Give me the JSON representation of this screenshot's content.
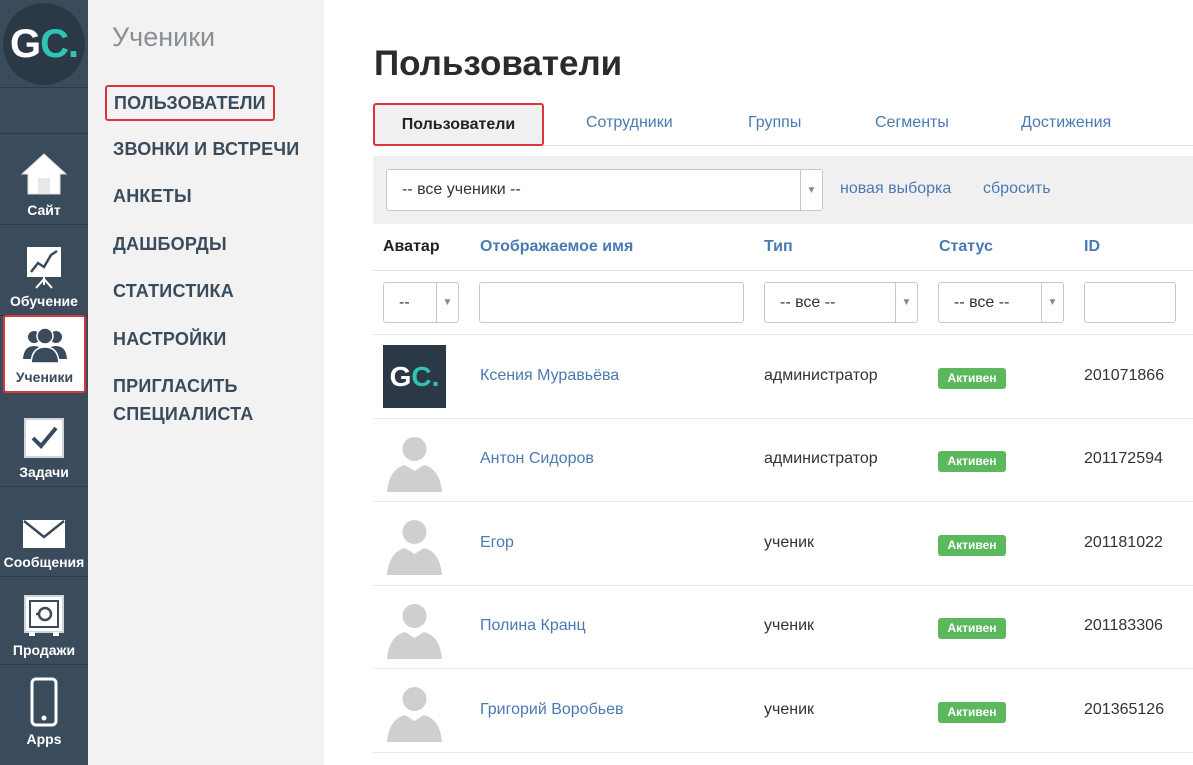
{
  "logo": {
    "g": "G",
    "c": "C."
  },
  "iconbar": {
    "items": [
      {
        "label": "Сайт",
        "icon": "home-icon"
      },
      {
        "label": "Обучение",
        "icon": "chart-board-icon"
      },
      {
        "label": "Ученики",
        "icon": "users-icon"
      },
      {
        "label": "Задачи",
        "icon": "checkbox-icon"
      },
      {
        "label": "Сообщения",
        "icon": "envelope-icon"
      },
      {
        "label": "Продажи",
        "icon": "safe-icon"
      },
      {
        "label": "Apps",
        "icon": "phone-icon"
      }
    ]
  },
  "sidebar": {
    "title": "Ученики",
    "links": [
      "ПОЛЬЗОВАТЕЛИ",
      "ЗВОНКИ И ВСТРЕЧИ",
      "АНКЕТЫ",
      "ДАШБОРДЫ",
      "СТАТИСТИКА",
      "НАСТРОЙКИ",
      "ПРИГЛАСИТЬ",
      "СПЕЦИАЛИСТА"
    ]
  },
  "main": {
    "title": "Пользователи",
    "tabs": [
      "Пользователи",
      "Сотрудники",
      "Группы",
      "Сегменты",
      "Достижения"
    ],
    "filter": {
      "selected": "-- все ученики --",
      "new_selection": "новая выборка",
      "reset": "сбросить"
    },
    "columns": {
      "avatar": "Аватар",
      "name": "Отображаемое имя",
      "type": "Тип",
      "status": "Статус",
      "id": "ID"
    },
    "column_filters": {
      "avatar": "--",
      "type": "-- все --",
      "status": "-- все --"
    },
    "rows": [
      {
        "name": "Ксения Муравьёва",
        "type": "администратор",
        "status": "Активен",
        "id": "201071866",
        "avatar": "gc-logo"
      },
      {
        "name": "Антон Сидоров",
        "type": "администратор",
        "status": "Активен",
        "id": "201172594",
        "avatar": "placeholder"
      },
      {
        "name": "Егор",
        "type": "ученик",
        "status": "Активен",
        "id": "201181022",
        "avatar": "placeholder"
      },
      {
        "name": "Полина Кранц",
        "type": "ученик",
        "status": "Активен",
        "id": "201183306",
        "avatar": "placeholder"
      },
      {
        "name": "Григорий Воробьев",
        "type": "ученик",
        "status": "Активен",
        "id": "201365126",
        "avatar": "placeholder"
      }
    ]
  },
  "colors": {
    "iconbar_bg": "#3a4b5c",
    "accent_teal": "#2ec4b6",
    "link": "#4a7ab3",
    "highlight_red": "#d9363e",
    "status_green": "#5cb85c"
  }
}
